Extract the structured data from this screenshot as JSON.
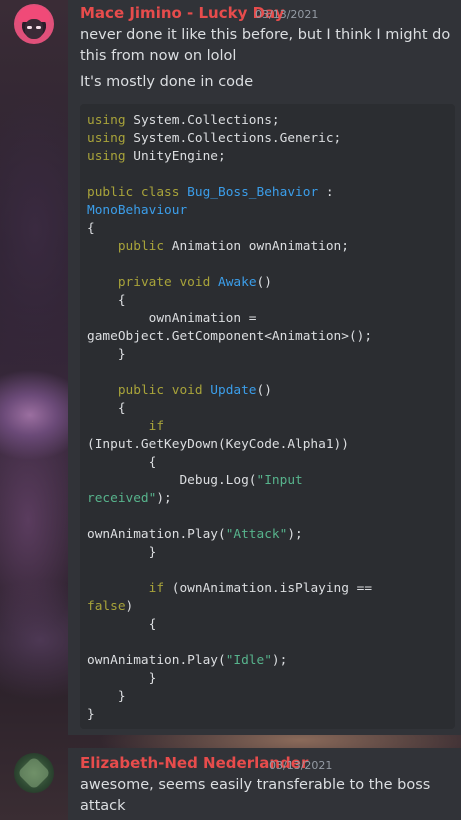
{
  "message1": {
    "username": "Mace Jimino - Lucky Day",
    "timestamp": "03/13/2021",
    "line1": "never done it like this before, but I think I might do",
    "line2": "this from now on lolol",
    "line3": "It's mostly done in code",
    "code_lines": [
      [
        [
          "kw",
          "using"
        ],
        [
          "p",
          " System.Collections;"
        ]
      ],
      [
        [
          "kw",
          "using"
        ],
        [
          "p",
          " System.Collections.Generic;"
        ]
      ],
      [
        [
          "kw",
          "using"
        ],
        [
          "p",
          " UnityEngine;"
        ]
      ],
      [
        [
          "p",
          ""
        ]
      ],
      [
        [
          "kw",
          "public class "
        ],
        [
          "ty",
          "Bug_Boss_Behavior"
        ],
        [
          "p",
          " :"
        ]
      ],
      [
        [
          "ty",
          "MonoBehaviour"
        ]
      ],
      [
        [
          "p",
          "{"
        ]
      ],
      [
        [
          "p",
          "    "
        ],
        [
          "kw",
          "public"
        ],
        [
          "p",
          " Animation ownAnimation;"
        ]
      ],
      [
        [
          "p",
          ""
        ]
      ],
      [
        [
          "p",
          "    "
        ],
        [
          "kw",
          "private void "
        ],
        [
          "fn",
          "Awake"
        ],
        [
          "p",
          "()"
        ]
      ],
      [
        [
          "p",
          "    {"
        ]
      ],
      [
        [
          "p",
          "        ownAnimation ="
        ]
      ],
      [
        [
          "p",
          "gameObject.GetComponent<Animation>();"
        ]
      ],
      [
        [
          "p",
          "    }"
        ]
      ],
      [
        [
          "p",
          ""
        ]
      ],
      [
        [
          "p",
          "    "
        ],
        [
          "kw",
          "public void "
        ],
        [
          "fn",
          "Update"
        ],
        [
          "p",
          "()"
        ]
      ],
      [
        [
          "p",
          "    {"
        ]
      ],
      [
        [
          "p",
          "        "
        ],
        [
          "kw",
          "if"
        ]
      ],
      [
        [
          "p",
          "(Input.GetKeyDown(KeyCode.Alpha1))"
        ]
      ],
      [
        [
          "p",
          "        {"
        ]
      ],
      [
        [
          "p",
          "            Debug.Log("
        ],
        [
          "str",
          "\"Input"
        ]
      ],
      [
        [
          "str",
          "received\""
        ],
        [
          "p",
          ");"
        ]
      ],
      [
        [
          "p",
          ""
        ]
      ],
      [
        [
          "p",
          "ownAnimation.Play("
        ],
        [
          "str",
          "\"Attack\""
        ],
        [
          "p",
          ");"
        ]
      ],
      [
        [
          "p",
          "        }"
        ]
      ],
      [
        [
          "p",
          ""
        ]
      ],
      [
        [
          "p",
          "        "
        ],
        [
          "kw",
          "if"
        ],
        [
          "p",
          " (ownAnimation.isPlaying =="
        ]
      ],
      [
        [
          "kw",
          "false"
        ],
        [
          "p",
          ")"
        ]
      ],
      [
        [
          "p",
          "        {"
        ]
      ],
      [
        [
          "p",
          ""
        ]
      ],
      [
        [
          "p",
          "ownAnimation.Play("
        ],
        [
          "str",
          "\"Idle\""
        ],
        [
          "p",
          ");"
        ]
      ],
      [
        [
          "p",
          "        }"
        ]
      ],
      [
        [
          "p",
          "    }"
        ]
      ],
      [
        [
          "p",
          "}"
        ]
      ]
    ]
  },
  "message2": {
    "username": "Elizabeth-Ned Nederlander",
    "timestamp": "03/13/2021",
    "line1": "awesome, seems easily transferable to the boss",
    "line2": "attack"
  },
  "colors": {
    "username": "#e74c4c",
    "keyword": "#a8a33a",
    "type": "#3b9eea",
    "string": "#57b38c",
    "panel": "#313338",
    "codeblock": "#2b2d31"
  }
}
